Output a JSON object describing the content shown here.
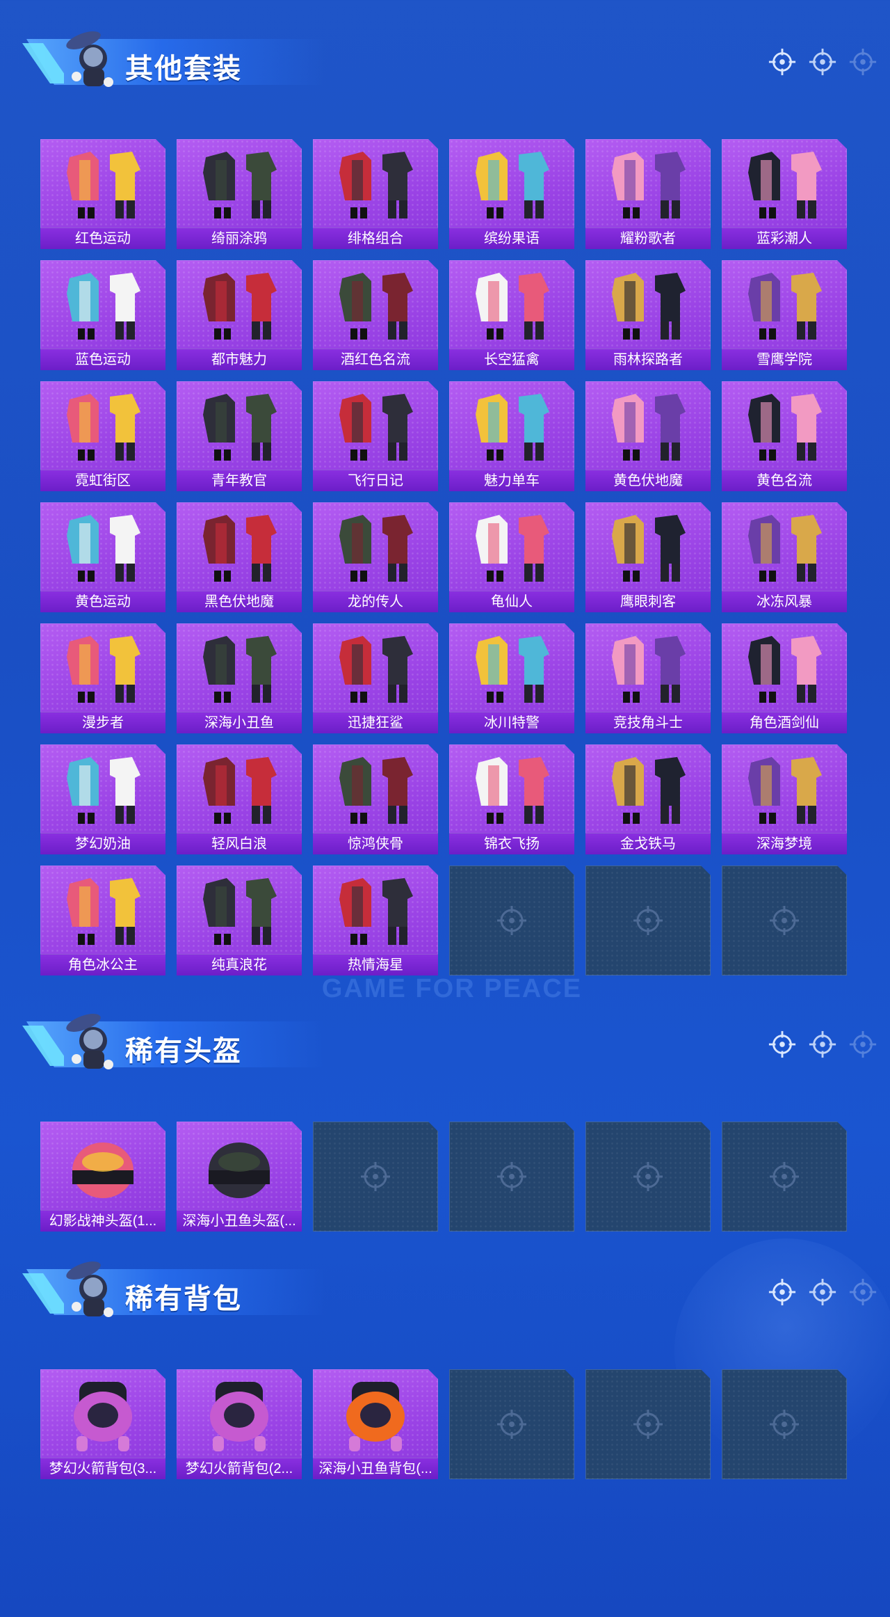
{
  "sections": [
    {
      "title": "其他套装",
      "rows": [
        [
          "红色运动",
          "绮丽涂鸦",
          "绯格组合",
          "缤纷果语",
          "耀粉歌者",
          "蓝彩潮人"
        ],
        [
          "蓝色运动",
          "都市魅力",
          "酒红色名流",
          "长空猛禽",
          "雨林探路者",
          "雪鹰学院"
        ],
        [
          "霓虹街区",
          "青年教官",
          "飞行日记",
          "魅力单车",
          "黄色伏地魔",
          "黄色名流"
        ],
        [
          "黄色运动",
          "黑色伏地魔",
          "龙的传人",
          "龟仙人",
          "鹰眼刺客",
          "冰冻风暴"
        ],
        [
          "漫步者",
          "深海小丑鱼",
          "迅捷狂鲨",
          "冰川特警",
          "竞技角斗士",
          "角色酒剑仙"
        ],
        [
          "梦幻奶油",
          "轻风白浪",
          "惊鸿侠骨",
          "锦衣飞扬",
          "金戈铁马",
          "深海梦境"
        ],
        [
          "角色冰公主",
          "纯真浪花",
          "热情海星",
          "",
          "",
          ""
        ]
      ]
    },
    {
      "title": "稀有头盔",
      "rows": [
        [
          "幻影战神头盔(1...",
          "深海小丑鱼头盔(...",
          "",
          "",
          "",
          ""
        ]
      ]
    },
    {
      "title": "稀有背包",
      "rows": [
        [
          "梦幻火箭背包(3...",
          "梦幻火箭背包(2...",
          "深海小丑鱼背包(...",
          "",
          "",
          ""
        ]
      ]
    }
  ],
  "watermark": "GAME FOR PEACE",
  "icons": {
    "header_mascot": "parachuting-soldier-icon",
    "header_reticle": "crosshair-icon",
    "empty_slot": "crosshair-icon"
  },
  "colors": {
    "background": "#1a4fc4",
    "card": "#9b44e6",
    "card_label": "#7a26d4",
    "empty_slot": "#24456e"
  }
}
